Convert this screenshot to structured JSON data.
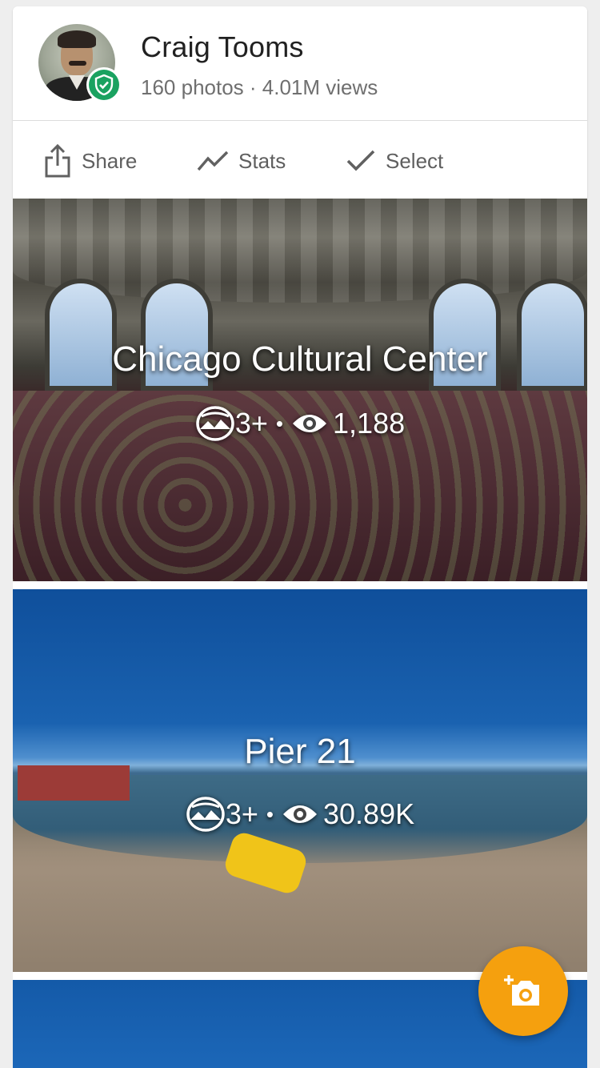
{
  "profile": {
    "name": "Craig Tooms",
    "stats": "160 photos · 4.01M views",
    "avatar_icon": "person-portrait",
    "badge_icon": "verified-shield-icon",
    "badge_color": "#1aa260"
  },
  "actions": [
    {
      "label": "Share",
      "icon": "share-icon"
    },
    {
      "label": "Stats",
      "icon": "trending-icon"
    },
    {
      "label": "Select",
      "icon": "check-icon"
    }
  ],
  "photos": [
    {
      "title": "Chicago Cultural Center",
      "count": "3+",
      "views": "1,188",
      "count_icon": "panorama-icon",
      "views_icon": "eye-icon"
    },
    {
      "title": "Pier 21",
      "count": "3+",
      "views": "30.89K",
      "count_icon": "panorama-icon",
      "views_icon": "eye-icon"
    },
    {
      "title": "",
      "count": "",
      "views": ""
    }
  ],
  "fab": {
    "icon": "add-photo-icon",
    "color": "#f5a00e"
  }
}
